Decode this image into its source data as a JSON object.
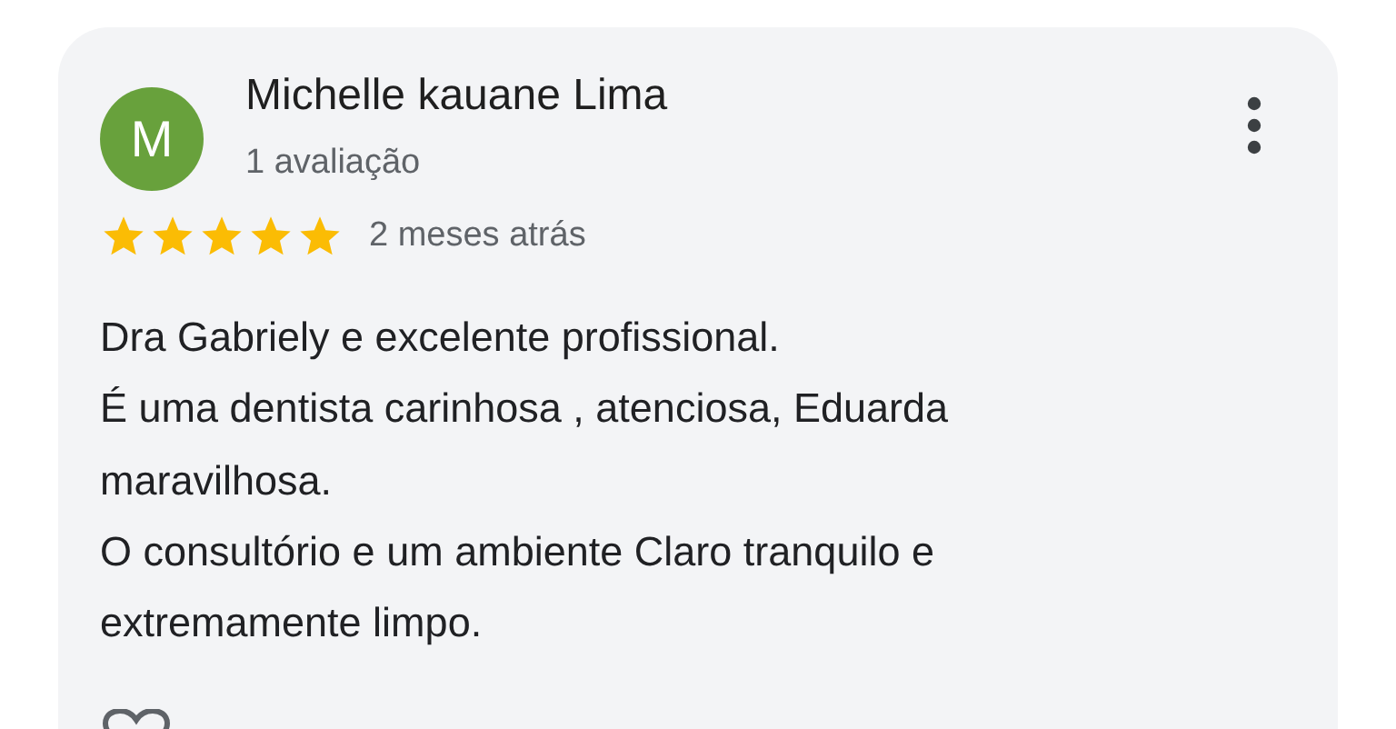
{
  "review": {
    "avatar_letter": "M",
    "author": "Michelle kauane Lima",
    "reviews_count": "1 avaliação",
    "stars": 5,
    "time": "2 meses atrás",
    "text": "Dra Gabriely e excelente profissional.\nÉ uma dentista carinhosa , atenciosa, Eduarda maravilhosa.\nO consultório e um ambiente Claro tranquilo e extremamente limpo."
  }
}
